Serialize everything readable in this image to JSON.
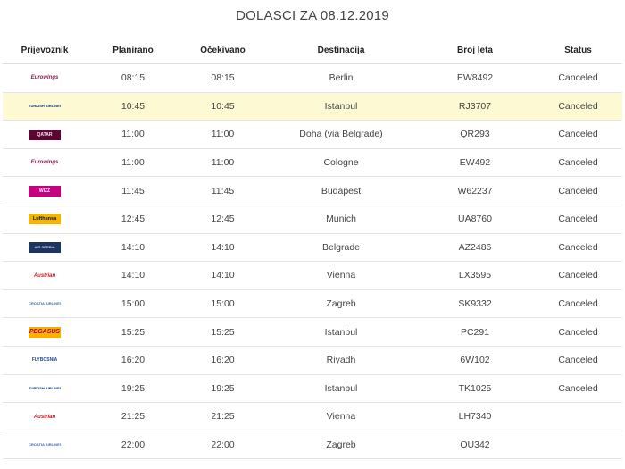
{
  "page": {
    "title": "DOLASCI ZA 08.12.2019"
  },
  "table": {
    "headers": [
      "Prijevoznik",
      "Planirano",
      "Očekivano",
      "Destinacija",
      "Broj leta",
      "Status"
    ],
    "rows": [
      {
        "airline": "Eurowings",
        "logo_icon": "eurowings-logo-icon",
        "logo_text": "Eurowings",
        "scheduled": "08:15",
        "expected": "08:15",
        "destination": "Berlin",
        "flight": "EW8492",
        "status": "Canceled"
      },
      {
        "airline": "Turkish Airlines",
        "logo_icon": "turkish-airlines-logo-icon",
        "logo_text": "TURKISH AIRLINES",
        "scheduled": "10:45",
        "expected": "10:45",
        "destination": "Istanbul",
        "flight": "RJ3707",
        "status": "Canceled",
        "highlighted": true
      },
      {
        "airline": "Qatar Airways",
        "logo_icon": "qatar-airways-logo-icon",
        "logo_text": "QATAR",
        "scheduled": "11:00",
        "expected": "11:00",
        "destination": "Doha (via Belgrade)",
        "flight": "QR293",
        "status": "Canceled"
      },
      {
        "airline": "Eurowings",
        "logo_icon": "eurowings-logo-icon",
        "logo_text": "Eurowings",
        "scheduled": "11:00",
        "expected": "11:00",
        "destination": "Cologne",
        "flight": "EW492",
        "status": "Canceled"
      },
      {
        "airline": "Wizz Air",
        "logo_icon": "wizz-air-logo-icon",
        "logo_text": "WIZZ",
        "scheduled": "11:45",
        "expected": "11:45",
        "destination": "Budapest",
        "flight": "W62237",
        "status": "Canceled"
      },
      {
        "airline": "Lufthansa",
        "logo_icon": "lufthansa-logo-icon",
        "logo_text": "Lufthansa",
        "scheduled": "12:45",
        "expected": "12:45",
        "destination": "Munich",
        "flight": "UA8760",
        "status": "Canceled"
      },
      {
        "airline": "Air Serbia",
        "logo_icon": "air-serbia-logo-icon",
        "logo_text": "AIR SERBIA",
        "scheduled": "14:10",
        "expected": "14:10",
        "destination": "Belgrade",
        "flight": "AZ2486",
        "status": "Canceled"
      },
      {
        "airline": "Austrian",
        "logo_icon": "austrian-logo-icon",
        "logo_text": "Austrian",
        "scheduled": "14:10",
        "expected": "14:10",
        "destination": "Vienna",
        "flight": "LX3595",
        "status": "Canceled"
      },
      {
        "airline": "Croatia Airlines",
        "logo_icon": "croatia-airlines-logo-icon",
        "logo_text": "CROATIA AIRLINES",
        "scheduled": "15:00",
        "expected": "15:00",
        "destination": "Zagreb",
        "flight": "SK9332",
        "status": "Canceled"
      },
      {
        "airline": "Pegasus",
        "logo_icon": "pegasus-logo-icon",
        "logo_text": "PEGASUS",
        "scheduled": "15:25",
        "expected": "15:25",
        "destination": "Istanbul",
        "flight": "PC291",
        "status": "Canceled"
      },
      {
        "airline": "FlyBosnia",
        "logo_icon": "flybosnia-logo-icon",
        "logo_text": "FLYBOSNIA",
        "scheduled": "16:20",
        "expected": "16:20",
        "destination": "Riyadh",
        "flight": "6W102",
        "status": "Canceled"
      },
      {
        "airline": "Turkish Airlines",
        "logo_icon": "turkish-airlines-logo-icon",
        "logo_text": "TURKISH AIRLINES",
        "scheduled": "19:25",
        "expected": "19:25",
        "destination": "Istanbul",
        "flight": "TK1025",
        "status": "Canceled"
      },
      {
        "airline": "Austrian",
        "logo_icon": "austrian-logo-icon",
        "logo_text": "Austrian",
        "scheduled": "21:25",
        "expected": "21:25",
        "destination": "Vienna",
        "flight": "LH7340",
        "status": ""
      },
      {
        "airline": "Croatia Airlines",
        "logo_icon": "croatia-airlines-logo-icon",
        "logo_text": "CROATIA AIRLINES",
        "scheduled": "22:00",
        "expected": "22:00",
        "destination": "Zagreb",
        "flight": "OU342",
        "status": ""
      }
    ]
  },
  "colors": {
    "highlight_row": "#fcf9d3",
    "row_border": "#e4e4e4"
  }
}
